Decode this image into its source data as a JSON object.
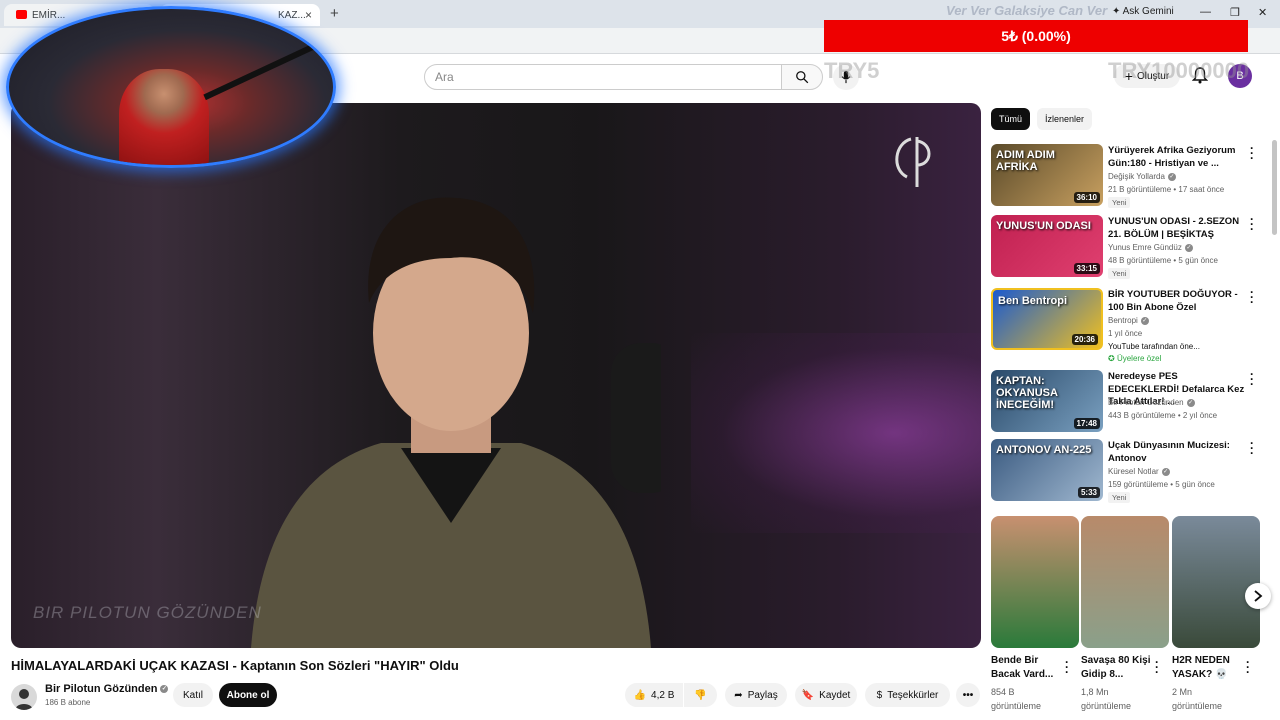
{
  "browser": {
    "tabs": [
      {
        "label": "EMİR..."
      },
      {
        "label": "KAZ..."
      }
    ],
    "new_tab": "+",
    "ask_gemini": "Ask Gemini",
    "window": {
      "minimize": "—",
      "maximize": "❐",
      "close": "✕"
    }
  },
  "overlay": {
    "ticker": "Ver Ver Galaksiye Can Ver",
    "donation_bar": "5₺ (0.00%)",
    "faint_left": "TRY5",
    "faint_right": "TRY10000000"
  },
  "header": {
    "search_placeholder": "Ara",
    "create_label": "Oluştur",
    "avatar_letter": "B"
  },
  "player": {
    "watermark": "BIR PILOTUN GÖZÜNDEN"
  },
  "video": {
    "title": "HİMALAYALARDAKİ UÇAK KAZASI - Kaptanın Son Sözleri \"HAYIR\" Oldu",
    "channel": "Bir Pilotun Gözünden",
    "subscribers": "186 B abone",
    "join_label": "Katıl",
    "subscribe_label": "Abone ol",
    "likes": "4,2 B",
    "share_label": "Paylaş",
    "save_label": "Kaydet",
    "thanks_label": "Teşekkürler"
  },
  "sidebar": {
    "chips": [
      {
        "label": "Tümü",
        "active": true
      },
      {
        "label": "İzlenenler",
        "active": false
      }
    ],
    "recommendations": [
      {
        "title": "Yürüyerek Afrika Geziyorum Gün:180 - Hristiyan ve ...",
        "channel": "Değişik Yollarda",
        "meta": "21 B görüntüleme • 17 saat önce",
        "badge": "Yeni",
        "duration": "36:10",
        "thumb_text": "ADIM ADIM AFRİKA",
        "thumb_colors": [
          "#5a4a2a",
          "#c8a060"
        ]
      },
      {
        "title": "YUNUS'UN ODASI - 2.SEZON 21. BÖLÜM | BEŞİKTAŞ",
        "channel": "Yunus Emre Gündüz",
        "meta": "48 B görüntüleme • 5 gün önce",
        "badge": "Yeni",
        "duration": "33:15",
        "thumb_text": "YUNUS'UN ODASI",
        "thumb_colors": [
          "#c02050",
          "#e04070"
        ]
      },
      {
        "title": "BİR YOUTUBER DOĞUYOR - 100 Bin Abone Özel",
        "channel": "Bentropi",
        "meta": "1 yıl önce",
        "extra": "YouTube tarafından öne...",
        "members": "Üyelere özel",
        "duration": "20:36",
        "thumb_text": "Ben Bentropi",
        "thumb_colors": [
          "#1a5ad0",
          "#f0c020"
        ]
      },
      {
        "title": "Neredeyse PES EDECEKLERDİ! Defalarca Kez Takla Attılar! ...",
        "channel": "Bir Pilotun Gözünden",
        "meta": "443 B görüntüleme • 2 yıl önce",
        "duration": "17:48",
        "thumb_text": "KAPTAN: OKYANUSA İNECEĞİM!",
        "thumb_colors": [
          "#2a4a6a",
          "#7aa0c0"
        ]
      },
      {
        "title": "Uçak Dünyasının Mucizesi: Antonov",
        "channel": "Küresel Notlar",
        "meta": "159 görüntüleme • 5 gün önce",
        "badge": "Yeni",
        "duration": "5:33",
        "thumb_text": "ANTONOV AN-225",
        "thumb_colors": [
          "#3a5a80",
          "#a0b8d0"
        ]
      }
    ],
    "shorts": [
      {
        "title": "Bende Bir Bacak Vard...",
        "views": "854 B görüntüleme",
        "colors": [
          "#c89070",
          "#2a7a3a"
        ]
      },
      {
        "title": "Savaşa 80 Kişi Gidip 8...",
        "views": "1,8 Mn görüntüleme",
        "colors": [
          "#b88a6a",
          "#8aa08a"
        ]
      },
      {
        "title": "H2R NEDEN YASAK? 💀",
        "views": "2 Mn görüntüleme",
        "colors": [
          "#7a8a9a",
          "#3a4a3a"
        ]
      }
    ]
  }
}
